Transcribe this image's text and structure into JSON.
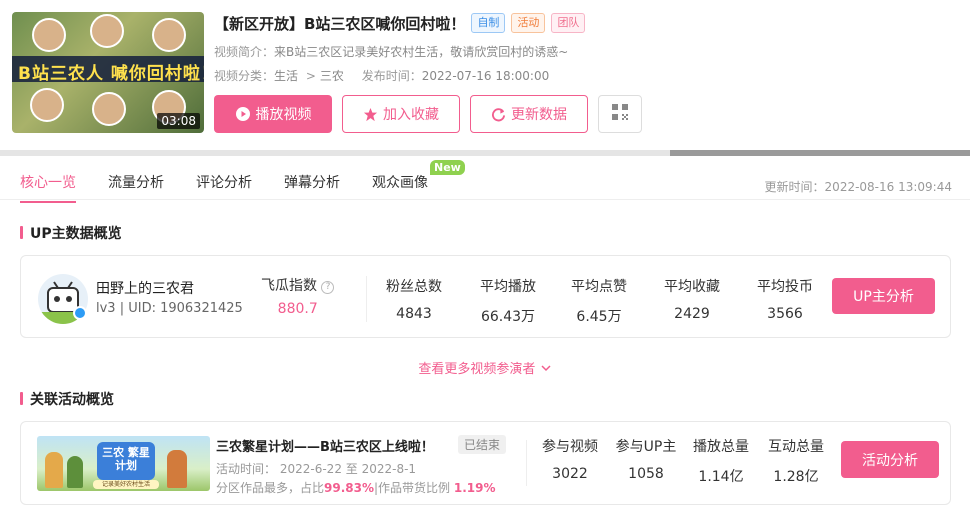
{
  "video": {
    "thumb_text": "B站三农人 喊你回村啦！",
    "duration": "03:08",
    "title": "【新区开放】B站三农区喊你回村啦！",
    "tags": [
      "自制",
      "活动",
      "团队"
    ],
    "intro_label": "视频简介：",
    "intro": "来B站三农区记录美好农村生活，敬请欣赏回村的诱惑~",
    "category_label": "视频分类：",
    "category_main": "生活",
    "category_arrow": ">",
    "category_sub": "三农",
    "publish_label": "发布时间：",
    "publish_time": "2022-07-16 18:00:00",
    "buttons": {
      "play": "播放视频",
      "favorite": "加入收藏",
      "refresh": "更新数据"
    }
  },
  "tabs": [
    "核心一览",
    "流量分析",
    "评论分析",
    "弹幕分析",
    "观众画像"
  ],
  "new_badge": "New",
  "update_time": "更新时间：2022-08-16 13:09:44",
  "up_section": {
    "title": "UP主数据概览",
    "name": "田野上的三农君",
    "sub": "lv3 | UID: 1906321425",
    "index_label": "飞瓜指数",
    "index_value": "880.7",
    "stats": [
      {
        "label": "粉丝总数",
        "value": "4843"
      },
      {
        "label": "平均播放",
        "value": "66.43万"
      },
      {
        "label": "平均点赞",
        "value": "6.45万"
      },
      {
        "label": "平均收藏",
        "value": "2429"
      },
      {
        "label": "平均投币",
        "value": "3566"
      }
    ],
    "button": "UP主分析"
  },
  "more_link": "查看更多视频参演者",
  "activity_section": {
    "title": "关联活动概览",
    "banner_text": "三农 繁星计划",
    "banner_sub": "记录美好农村生活",
    "name": "三农繁星计划——B站三农区上线啦！",
    "status": "已结束",
    "time_label": "活动时间：",
    "time_value": "2022-6-22 至 2022-8-1",
    "share_prefix": "分区作品最多，占比",
    "share_value": "99.83%",
    "share_mid": "|作品带货比例",
    "share_value2": "1.19%",
    "stats": [
      {
        "label": "参与视频",
        "value": "3022"
      },
      {
        "label": "参与UP主",
        "value": "1058"
      },
      {
        "label": "播放总量",
        "value": "1.14亿"
      },
      {
        "label": "互动总量",
        "value": "1.28亿"
      }
    ],
    "button": "活动分析"
  },
  "colors": {
    "accent": "#f25d8e",
    "new_badge": "#8fd14f"
  }
}
